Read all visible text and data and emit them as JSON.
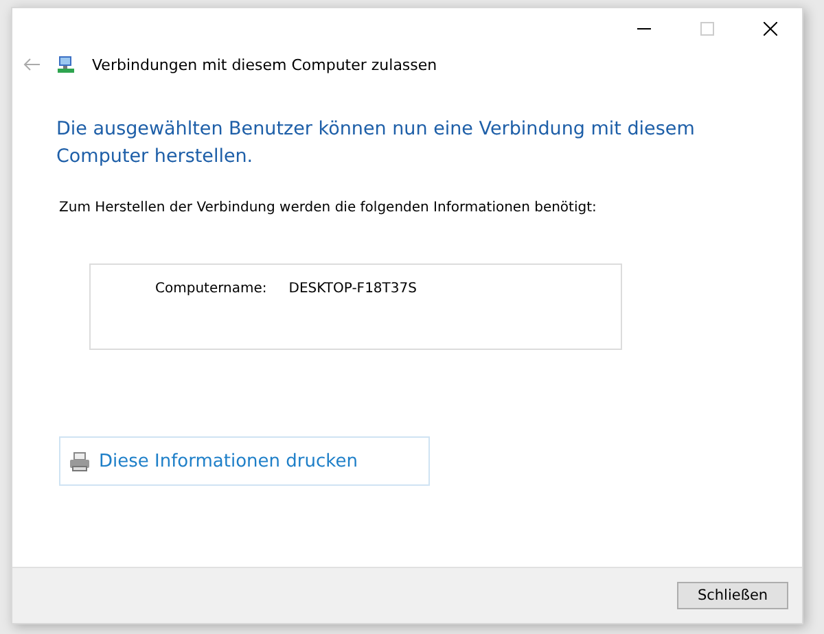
{
  "window": {
    "title": "Verbindungen mit diesem Computer zulassen"
  },
  "heading": "Die ausgewählten Benutzer können nun eine Verbindung mit diesem Computer herstellen.",
  "intro": "Zum Herstellen der Verbindung werden die folgenden Informationen benötigt:",
  "info": [
    {
      "label": "Computername:",
      "value": "DESKTOP-F18T37S"
    }
  ],
  "print_link": "Diese Informationen drucken",
  "buttons": [
    "Schließen"
  ]
}
